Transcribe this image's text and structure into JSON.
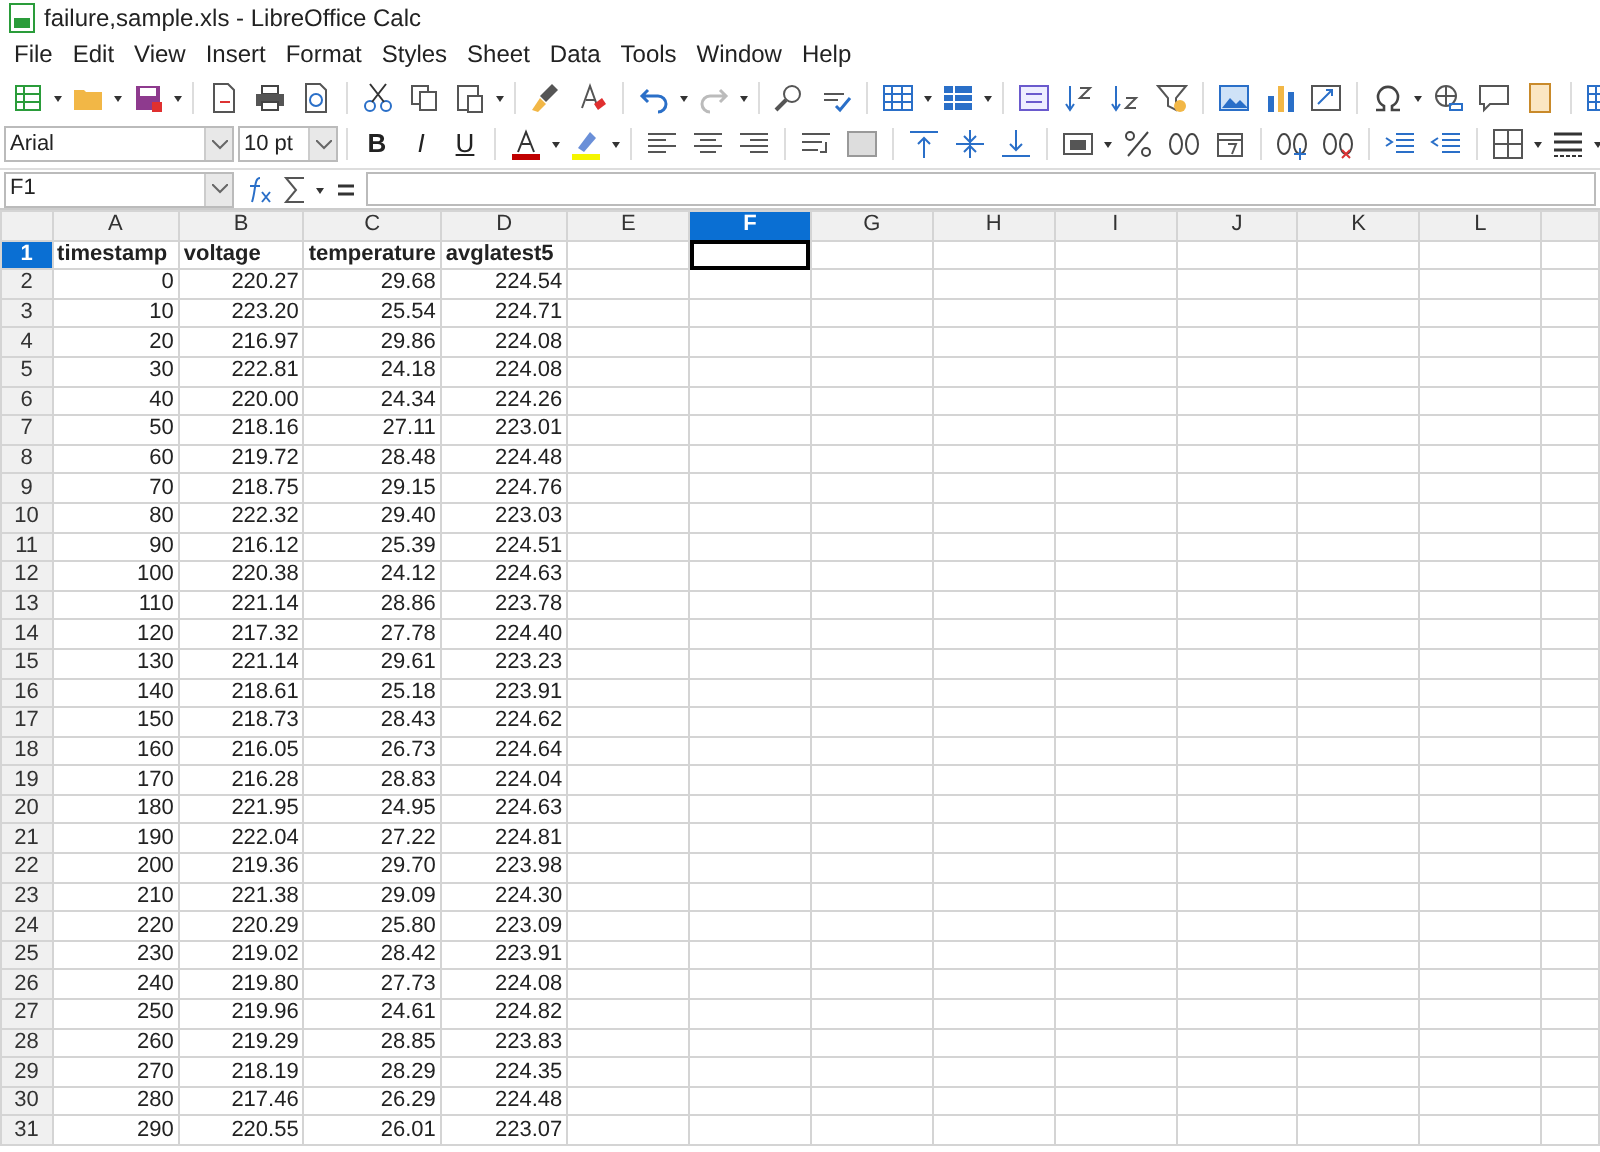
{
  "window": {
    "title": "failure,sample.xls - LibreOffice Calc"
  },
  "menu": [
    "File",
    "Edit",
    "View",
    "Insert",
    "Format",
    "Styles",
    "Sheet",
    "Data",
    "Tools",
    "Window",
    "Help"
  ],
  "format_bar": {
    "font": "Arial",
    "size": "10 pt",
    "text_buttons": [
      "B",
      "I",
      "U"
    ]
  },
  "formula_bar": {
    "name_box": "F1"
  },
  "sheet": {
    "columns": [
      {
        "label": "A",
        "selected": false
      },
      {
        "label": "B",
        "selected": false
      },
      {
        "label": "C",
        "selected": false
      },
      {
        "label": "D",
        "selected": false
      },
      {
        "label": "E",
        "selected": false
      },
      {
        "label": "F",
        "selected": true
      },
      {
        "label": "G",
        "selected": false
      },
      {
        "label": "H",
        "selected": false
      },
      {
        "label": "I",
        "selected": false
      },
      {
        "label": "J",
        "selected": false
      },
      {
        "label": "K",
        "selected": false
      },
      {
        "label": "L",
        "selected": false
      }
    ],
    "rows": [
      {
        "number": "1",
        "selected": true,
        "kind": "header",
        "cells": [
          "timestamp",
          "voltage",
          "temperature",
          "avglatest5"
        ]
      },
      {
        "number": "2",
        "selected": false,
        "kind": "data",
        "cells": [
          "0",
          "220.27",
          "29.68",
          "224.54"
        ]
      },
      {
        "number": "3",
        "selected": false,
        "kind": "data",
        "cells": [
          "10",
          "223.20",
          "25.54",
          "224.71"
        ]
      },
      {
        "number": "4",
        "selected": false,
        "kind": "data",
        "cells": [
          "20",
          "216.97",
          "29.86",
          "224.08"
        ]
      },
      {
        "number": "5",
        "selected": false,
        "kind": "data",
        "cells": [
          "30",
          "222.81",
          "24.18",
          "224.08"
        ]
      },
      {
        "number": "6",
        "selected": false,
        "kind": "data",
        "cells": [
          "40",
          "220.00",
          "24.34",
          "224.26"
        ]
      },
      {
        "number": "7",
        "selected": false,
        "kind": "data",
        "cells": [
          "50",
          "218.16",
          "27.11",
          "223.01"
        ]
      },
      {
        "number": "8",
        "selected": false,
        "kind": "data",
        "cells": [
          "60",
          "219.72",
          "28.48",
          "224.48"
        ]
      },
      {
        "number": "9",
        "selected": false,
        "kind": "data",
        "cells": [
          "70",
          "218.75",
          "29.15",
          "224.76"
        ]
      },
      {
        "number": "10",
        "selected": false,
        "kind": "data",
        "cells": [
          "80",
          "222.32",
          "29.40",
          "223.03"
        ]
      },
      {
        "number": "11",
        "selected": false,
        "kind": "data",
        "cells": [
          "90",
          "216.12",
          "25.39",
          "224.51"
        ]
      },
      {
        "number": "12",
        "selected": false,
        "kind": "data",
        "cells": [
          "100",
          "220.38",
          "24.12",
          "224.63"
        ]
      },
      {
        "number": "13",
        "selected": false,
        "kind": "data",
        "cells": [
          "110",
          "221.14",
          "28.86",
          "223.78"
        ]
      },
      {
        "number": "14",
        "selected": false,
        "kind": "data",
        "cells": [
          "120",
          "217.32",
          "27.78",
          "224.40"
        ]
      },
      {
        "number": "15",
        "selected": false,
        "kind": "data",
        "cells": [
          "130",
          "221.14",
          "29.61",
          "223.23"
        ]
      },
      {
        "number": "16",
        "selected": false,
        "kind": "data",
        "cells": [
          "140",
          "218.61",
          "25.18",
          "223.91"
        ]
      },
      {
        "number": "17",
        "selected": false,
        "kind": "data",
        "cells": [
          "150",
          "218.73",
          "28.43",
          "224.62"
        ]
      },
      {
        "number": "18",
        "selected": false,
        "kind": "data",
        "cells": [
          "160",
          "216.05",
          "26.73",
          "224.64"
        ]
      },
      {
        "number": "19",
        "selected": false,
        "kind": "data",
        "cells": [
          "170",
          "216.28",
          "28.83",
          "224.04"
        ]
      },
      {
        "number": "20",
        "selected": false,
        "kind": "data",
        "cells": [
          "180",
          "221.95",
          "24.95",
          "224.63"
        ]
      },
      {
        "number": "21",
        "selected": false,
        "kind": "data",
        "cells": [
          "190",
          "222.04",
          "27.22",
          "224.81"
        ]
      },
      {
        "number": "22",
        "selected": false,
        "kind": "data",
        "cells": [
          "200",
          "219.36",
          "29.70",
          "223.98"
        ]
      },
      {
        "number": "23",
        "selected": false,
        "kind": "data",
        "cells": [
          "210",
          "221.38",
          "29.09",
          "224.30"
        ]
      },
      {
        "number": "24",
        "selected": false,
        "kind": "data",
        "cells": [
          "220",
          "220.29",
          "25.80",
          "223.09"
        ]
      },
      {
        "number": "25",
        "selected": false,
        "kind": "data",
        "cells": [
          "230",
          "219.02",
          "28.42",
          "223.91"
        ]
      },
      {
        "number": "26",
        "selected": false,
        "kind": "data",
        "cells": [
          "240",
          "219.80",
          "27.73",
          "224.08"
        ]
      },
      {
        "number": "27",
        "selected": false,
        "kind": "data",
        "cells": [
          "250",
          "219.96",
          "24.61",
          "224.82"
        ]
      },
      {
        "number": "28",
        "selected": false,
        "kind": "data",
        "cells": [
          "260",
          "219.29",
          "28.85",
          "223.83"
        ]
      },
      {
        "number": "29",
        "selected": false,
        "kind": "data",
        "cells": [
          "270",
          "218.19",
          "28.29",
          "224.35"
        ]
      },
      {
        "number": "30",
        "selected": false,
        "kind": "data",
        "cells": [
          "280",
          "217.46",
          "26.29",
          "224.48"
        ]
      },
      {
        "number": "31",
        "selected": false,
        "kind": "data",
        "cells": [
          "290",
          "220.55",
          "26.01",
          "223.07"
        ]
      }
    ]
  }
}
